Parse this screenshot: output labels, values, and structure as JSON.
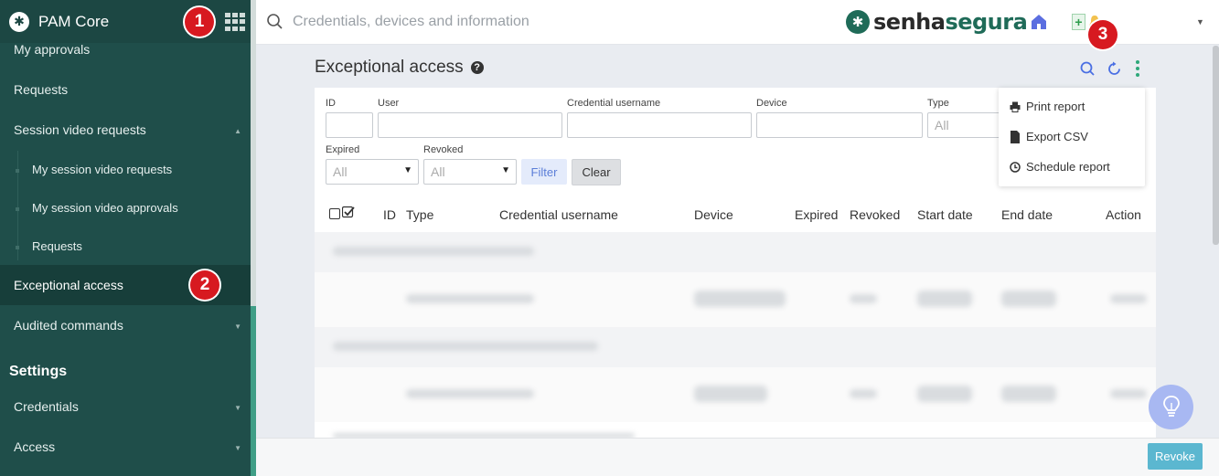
{
  "sidebar": {
    "app_name": "PAM Core",
    "items": [
      {
        "label": "My approvals"
      },
      {
        "label": "Requests"
      },
      {
        "label": "Session video requests"
      },
      {
        "label": "My session video requests"
      },
      {
        "label": "My session video approvals"
      },
      {
        "label": "Requests"
      },
      {
        "label": "Exceptional access"
      },
      {
        "label": "Audited commands"
      }
    ],
    "section_title": "Settings",
    "settings_items": [
      {
        "label": "Credentials"
      },
      {
        "label": "Access"
      }
    ]
  },
  "badges": [
    "1",
    "2",
    "3"
  ],
  "topbar": {
    "search_placeholder": "Credentials, devices and information",
    "brand_prefix": "senha",
    "brand_suffix": "segura"
  },
  "page": {
    "title": "Exceptional access",
    "help": "?"
  },
  "filters": {
    "labels": {
      "id": "ID",
      "user": "User",
      "credential_username": "Credential username",
      "device": "Device",
      "type": "Type",
      "expired": "Expired",
      "revoked": "Revoked"
    },
    "type_value": "All",
    "expired_value": "All",
    "revoked_value": "All",
    "filter_button": "Filter",
    "clear_button": "Clear"
  },
  "table": {
    "columns": [
      "ID",
      "Type",
      "Credential username",
      "Device",
      "Expired",
      "Revoked",
      "Start date",
      "End date",
      "Action"
    ]
  },
  "menu": {
    "items": [
      {
        "label": "Print report",
        "icon": "printer-icon"
      },
      {
        "label": "Export CSV",
        "icon": "file-icon"
      },
      {
        "label": "Schedule report",
        "icon": "clock-icon"
      }
    ]
  },
  "footer": {
    "revoke_button": "Revoke"
  },
  "colors": {
    "sidebar": "#1f4e4a",
    "accent": "#1f6b58",
    "badge": "#d71920",
    "revoke": "#5bb7d0"
  }
}
